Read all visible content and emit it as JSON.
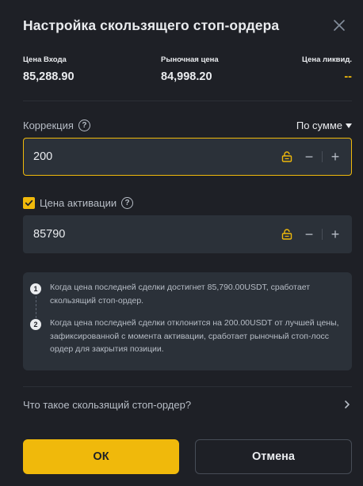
{
  "dialog": {
    "title": "Настройка скользящего стоп-ордера"
  },
  "stats": [
    {
      "label": "Цена Входа",
      "value": "85,288.90"
    },
    {
      "label": "Рыночная цена",
      "value": "84,998.20"
    },
    {
      "label": "Цена ликвид.",
      "value": "--"
    }
  ],
  "correction": {
    "label": "Коррекция",
    "help": "?",
    "mode": "По сумме",
    "value": "200",
    "minus": "−",
    "plus": "+"
  },
  "activation": {
    "label": "Цена активации",
    "help": "?",
    "checked": true,
    "value": "85790",
    "minus": "−",
    "plus": "+"
  },
  "info": {
    "steps": [
      {
        "num": "1",
        "text": "Когда цена последней сделки достигнет 85,790.00USDT, сработает скользящий стоп-ордер."
      },
      {
        "num": "2",
        "text": "Когда цена последней сделки отклонится на 200.00USDT от лучшей цены, зафиксированной с момента активации, сработает рыночный стоп-лосс ордер для закрытия позиции."
      }
    ]
  },
  "faq": {
    "label": "Что такое скользящий стоп-ордер?"
  },
  "buttons": {
    "ok": "ОК",
    "cancel": "Отмена"
  },
  "colors": {
    "accent": "#f0b90b",
    "background": "#1e2026",
    "input": "#2b3139"
  },
  "icons": {
    "close": "close-icon",
    "lock": "lock-icon",
    "help": "help-icon",
    "chevron": "chevron-right-icon",
    "check": "check-icon"
  }
}
